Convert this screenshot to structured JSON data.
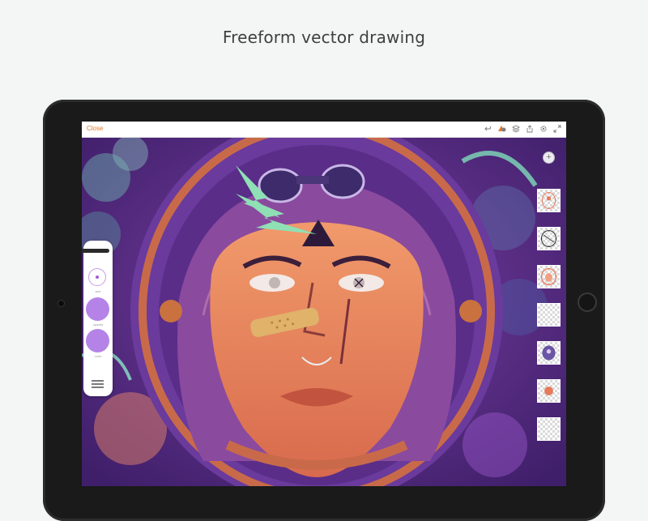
{
  "headline": "Freeform vector drawing",
  "toolbar": {
    "close_label": "Close",
    "icons": [
      "undo-icon",
      "shapes-icon",
      "layers-icon",
      "share-icon",
      "settings-icon",
      "fullscreen-icon"
    ]
  },
  "tool_panel": {
    "size_label": "size",
    "opacity_label": "opacity",
    "color_label": "color",
    "swatch_color": "#b583e8"
  },
  "layers": {
    "add_label": "+",
    "count": 7
  },
  "colors": {
    "accent": "#e07a2a",
    "artwork_purple": "#5b2e86",
    "face_orange": "#e9875f"
  }
}
